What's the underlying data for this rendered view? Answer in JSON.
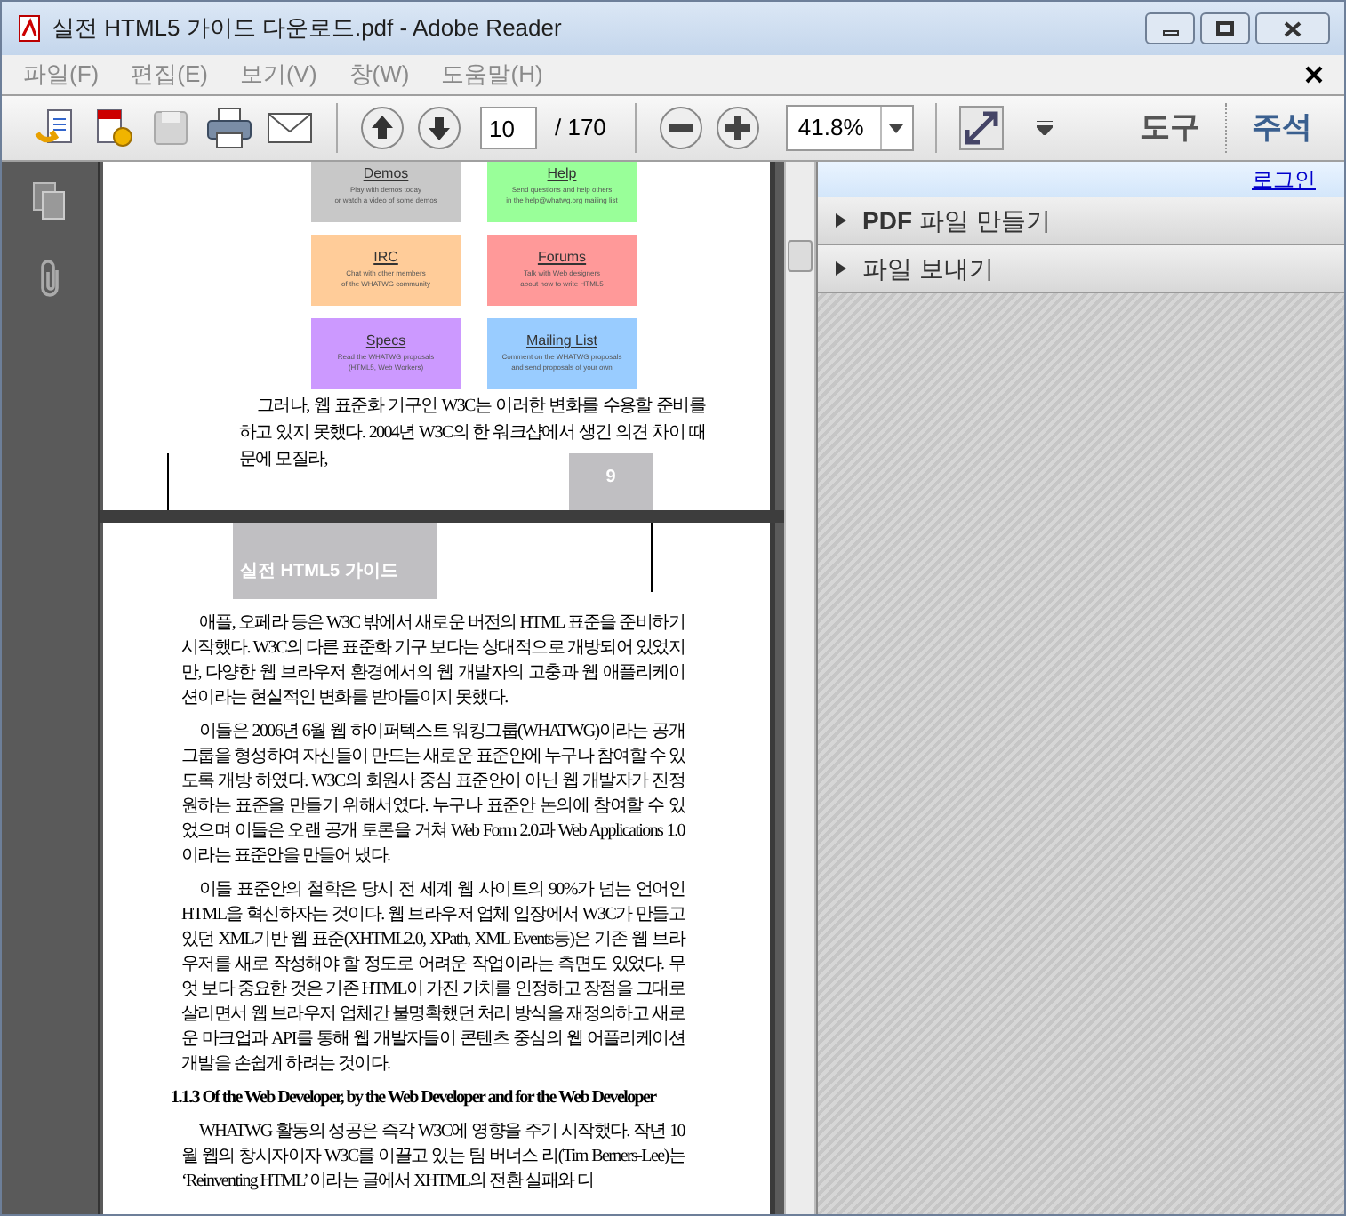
{
  "window": {
    "title": "실전 HTML5 가이드 다운로드.pdf - Adobe Reader"
  },
  "menu": [
    "파일(F)",
    "편집(E)",
    "보기(V)",
    "창(W)",
    "도움말(H)"
  ],
  "toolbar": {
    "page_number": "10",
    "page_total": "/ 170",
    "zoom": "41.8%",
    "panels": [
      "도구",
      "주석"
    ]
  },
  "document": {
    "figure_boxes": [
      {
        "title": "Demos",
        "lines": [
          "Play with demos today",
          "or watch a video of some demos"
        ],
        "color": "#c8c8c8"
      },
      {
        "title": "Help",
        "lines": [
          "Send questions and help others",
          "in the help@whatwg.org mailing list"
        ],
        "color": "#99ff99"
      },
      {
        "title": "IRC",
        "lines": [
          "Chat with other members",
          "of the WHATWG community"
        ],
        "color": "#ffcc99"
      },
      {
        "title": "Forums",
        "lines": [
          "Talk with Web designers",
          "about how to write HTML5"
        ],
        "color": "#ff9999"
      },
      {
        "title": "Specs",
        "lines": [
          "Read the WHATWG proposals",
          "(HTML5, Web Workers)"
        ],
        "color": "#cc99ff"
      },
      {
        "title": "Mailing List",
        "lines": [
          "Comment on the WHATWG proposals",
          "and send proposals of your own"
        ],
        "color": "#99ccff"
      }
    ],
    "page1_paragraph": "그러나, 웹 표준화 기구인 W3C는 이러한 변화를 수용할 준비를 하고 있지 못했다. 2004년 W3C의 한 워크샵에서 생긴 의견 차이 때문에 모질라,",
    "page_number": "9",
    "running_header": "실전 HTML5 가이드",
    "paragraphs": [
      "애플, 오페라 등은 W3C 밖에서 새로운 버전의 HTML 표준을 준비하기 시작했다. W3C의 다른 표준화 기구 보다는 상대적으로 개방되어 있었지만, 다양한 웹 브라우저 환경에서의 웹 개발자의 고충과 웹 애플리케이션이라는 현실적인 변화를 받아들이지 못했다.",
      "이들은 2006년 6월 웹 하이퍼텍스트 워킹그룹(WHATWG)이라는 공개 그룹을 형성하여 자신들이 만드는 새로운 표준안에 누구나 참여할 수 있도록 개방 하였다. W3C의 회원사 중심 표준안이 아닌 웹 개발자가 진정 원하는 표준을 만들기 위해서였다. 누구나 표준안 논의에 참여할 수 있었으며 이들은 오랜 공개 토론을 거쳐 Web Form 2.0과 Web Applications 1.0이라는 표준안을 만들어 냈다.",
      "이들 표준안의 철학은 당시 전 세계 웹 사이트의 90%가 넘는 언어인 HTML을 혁신하자는 것이다. 웹 브라우저 업체 입장에서 W3C가 만들고 있던 XML기반 웹 표준(XHTML2.0, XPath, XML Events등)은 기존 웹 브라우저를 새로 작성해야 할 정도로 어려운 작업이라는 측면도 있었다. 무엇 보다 중요한 것은 기존 HTML이 가진 가치를 인정하고 장점을 그대로 살리면서 웹 브라우저 업체간 불명확했던 처리 방식을 재정의하고 새로운 마크업과 API를 통해 웹 개발자들이 콘텐츠 중심의 웹 어플리케이션 개발을 손쉽게 하려는 것이다."
    ],
    "section_heading": "1.1.3 Of the Web Developer, by the Web Developer and for the Web Developer",
    "last_paragraph": "WHATWG 활동의 성공은 즉각 W3C에 영향을 주기 시작했다. 작년 10월 웹의 창시자이자 W3C를 이끌고 있는 팀 버너스 리(Tim Berners-Lee)는 ‘Reinventing HTML’ 이라는 글에서 XHTML의 전환 실패와 디"
  },
  "right_panel": {
    "login": "로그인",
    "sections": [
      {
        "label": "**PDF** 파일 만들기",
        "expanded": false
      },
      {
        "label": "파일 보내기",
        "expanded": false
      }
    ]
  }
}
